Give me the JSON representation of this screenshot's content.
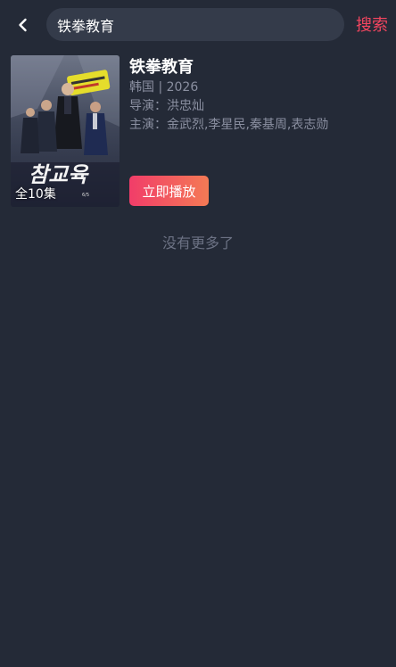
{
  "header": {
    "back_icon": "chevron-left-icon",
    "search_value": "铁拳教育",
    "search_button_label": "搜索",
    "accent_color": "#f2455f"
  },
  "results": [
    {
      "title": "铁拳教育",
      "meta": "韩国 | 2026",
      "director": "导演：洪忠灿",
      "cast": "主演：金武烈,李星民,秦基周,表志勋",
      "episodes": "全10集",
      "poster_title": "참교육",
      "play_label": "立即播放"
    }
  ],
  "footer": {
    "no_more_text": "没有更多了"
  }
}
